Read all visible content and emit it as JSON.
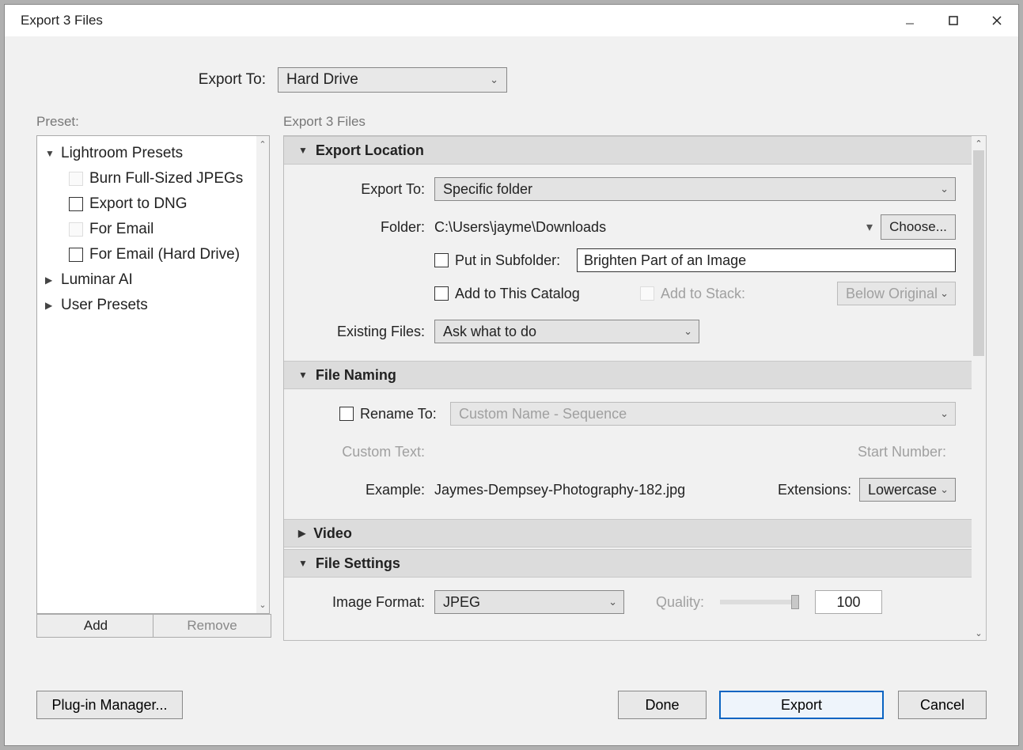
{
  "window": {
    "title": "Export 3 Files"
  },
  "top": {
    "export_to_label": "Export To:",
    "export_to_value": "Hard Drive"
  },
  "labels": {
    "preset": "Preset:",
    "export_count": "Export 3 Files"
  },
  "presets": {
    "groups": [
      {
        "label": "Lightroom Presets",
        "expanded": true
      },
      {
        "label": "Luminar AI",
        "expanded": false
      },
      {
        "label": "User Presets",
        "expanded": false
      }
    ],
    "lr_children": [
      {
        "label": "Burn Full-Sized JPEGs",
        "box": "ghost"
      },
      {
        "label": "Export to DNG",
        "box": "real"
      },
      {
        "label": "For Email",
        "box": "ghost"
      },
      {
        "label": "For Email (Hard Drive)",
        "box": "real"
      }
    ],
    "add_label": "Add",
    "remove_label": "Remove"
  },
  "sections": {
    "export_location": {
      "title": "Export Location",
      "export_to_label": "Export To:",
      "export_to_value": "Specific folder",
      "folder_label": "Folder:",
      "folder_value": "C:\\Users\\jayme\\Downloads",
      "choose_label": "Choose...",
      "put_sub_label": "Put in Subfolder:",
      "put_sub_value": "Brighten Part of an Image",
      "add_catalog_label": "Add to This Catalog",
      "add_stack_label": "Add to Stack:",
      "stack_value": "Below Original",
      "existing_label": "Existing Files:",
      "existing_value": "Ask what to do"
    },
    "file_naming": {
      "title": "File Naming",
      "rename_label": "Rename To:",
      "rename_value": "Custom Name - Sequence",
      "custom_text_label": "Custom Text:",
      "start_number_label": "Start Number:",
      "example_label": "Example:",
      "example_value": "Jaymes-Dempsey-Photography-182.jpg",
      "extensions_label": "Extensions:",
      "extensions_value": "Lowercase"
    },
    "video": {
      "title": "Video"
    },
    "file_settings": {
      "title": "File Settings",
      "format_label": "Image Format:",
      "format_value": "JPEG",
      "quality_label": "Quality:",
      "quality_value": "100"
    }
  },
  "footer": {
    "plugin": "Plug-in Manager...",
    "done": "Done",
    "export": "Export",
    "cancel": "Cancel"
  }
}
